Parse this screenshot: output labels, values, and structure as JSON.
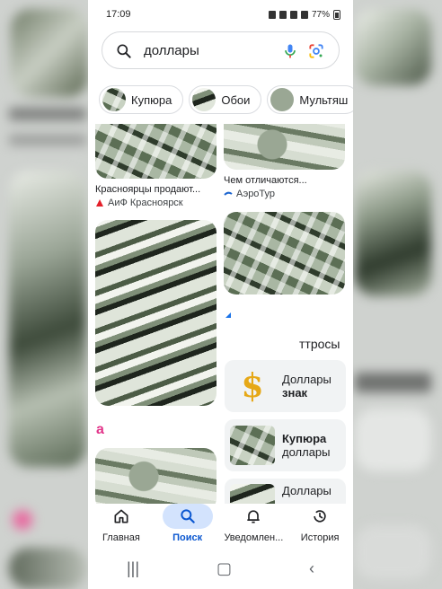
{
  "status_bar": {
    "time": "17:09",
    "battery": "77%"
  },
  "search": {
    "query": "доллары"
  },
  "chips": [
    {
      "label": "Купюра"
    },
    {
      "label": "Обои"
    },
    {
      "label": "Мультяш"
    }
  ],
  "results": {
    "left": [
      {
        "caption": "Красноярцы продают...",
        "source": "АиФ Красноярск"
      },
      {
        "caption": "",
        "source": ""
      },
      {
        "caption": "",
        "source": ""
      }
    ],
    "right": [
      {
        "caption": "Чем отличаются...",
        "source": "АэроТур"
      },
      {
        "caption": "",
        "source": ""
      }
    ]
  },
  "related": {
    "title": "ттросы",
    "items": [
      {
        "line1": "Доллары",
        "line2": "знак"
      },
      {
        "line1": "Купюра",
        "line2": "доллары"
      },
      {
        "line1": "Доллары",
        "line2": ""
      }
    ]
  },
  "bottom_nav": [
    {
      "label": "Главная",
      "icon": "home-icon"
    },
    {
      "label": "Поиск",
      "icon": "search-icon"
    },
    {
      "label": "Уведомлен...",
      "icon": "bell-icon"
    },
    {
      "label": "История",
      "icon": "history-icon"
    }
  ],
  "colors": {
    "accent": "#0b57d0",
    "active_bg": "#d3e3fd"
  }
}
